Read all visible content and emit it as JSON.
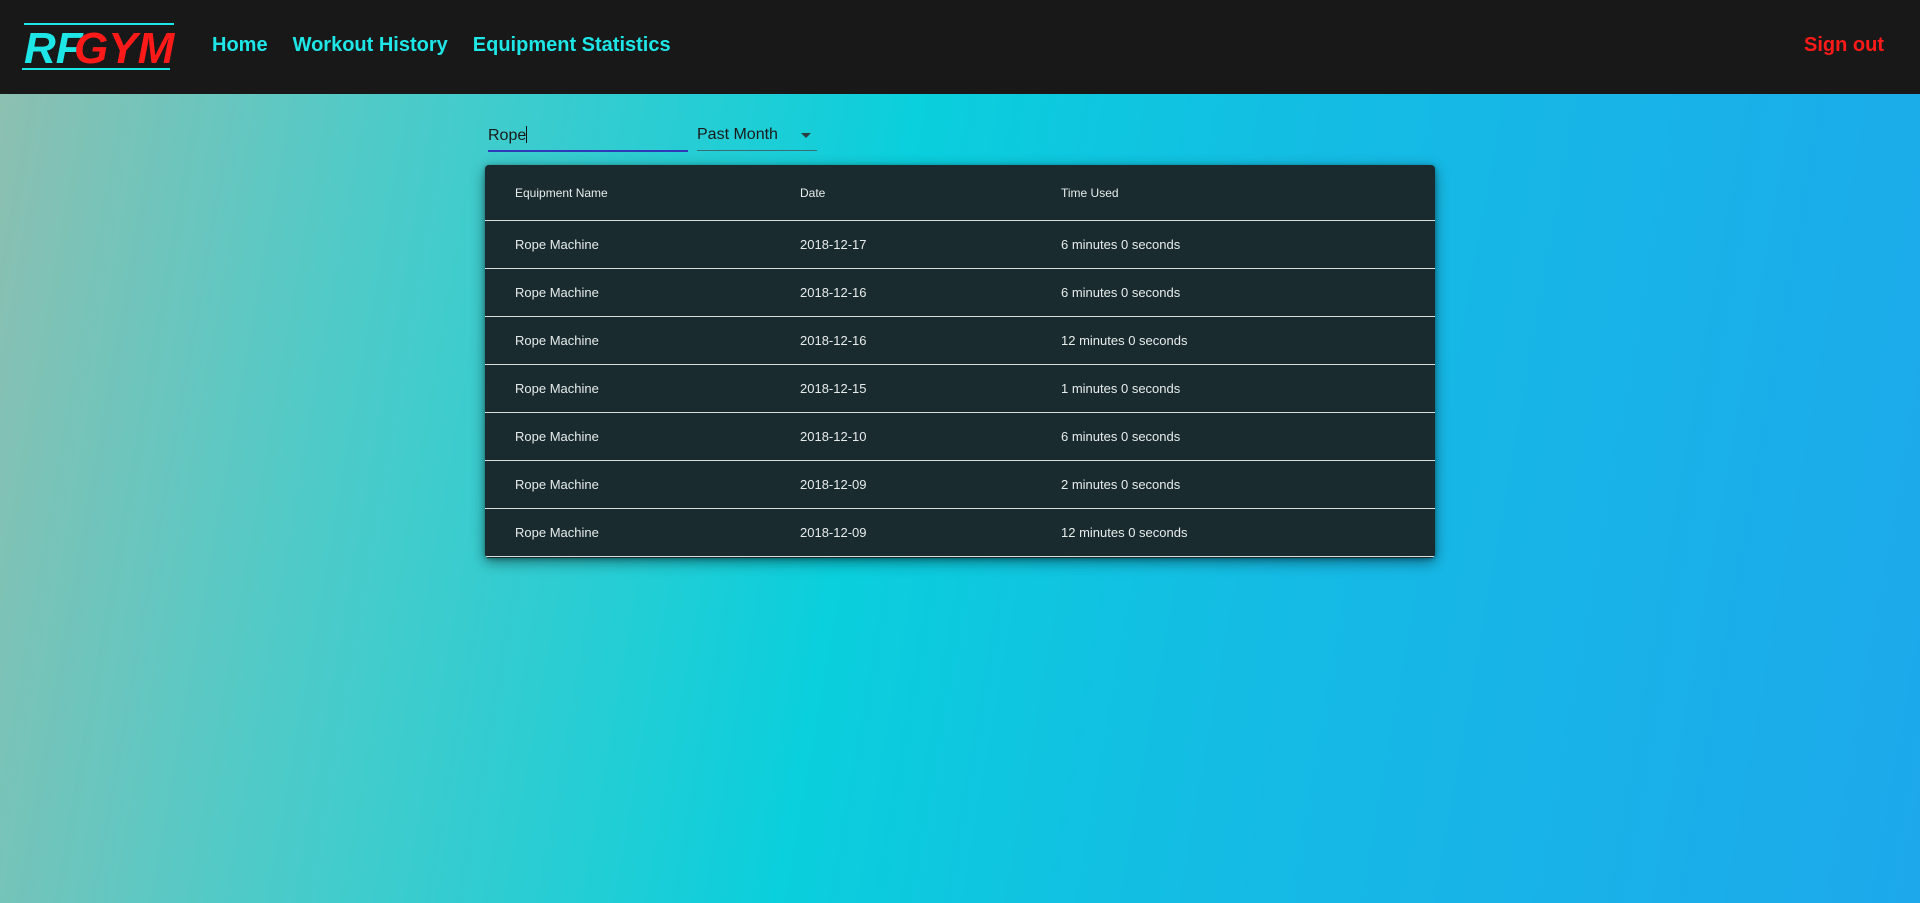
{
  "header": {
    "logo": {
      "part1": "RF",
      "part2": "GYM",
      "color1": "#1ee6e6",
      "color2": "#ff1a1a"
    },
    "nav": [
      {
        "label": "Home"
      },
      {
        "label": "Workout History"
      },
      {
        "label": "Equipment Statistics"
      }
    ],
    "sign_out": "Sign out"
  },
  "filters": {
    "search_value": "Rope",
    "period_selected": "Past Month"
  },
  "table": {
    "columns": [
      "Equipment Name",
      "Date",
      "Time Used"
    ],
    "rows": [
      [
        "Rope Machine",
        "2018-12-17",
        "6 minutes 0 seconds"
      ],
      [
        "Rope Machine",
        "2018-12-16",
        "6 minutes 0 seconds"
      ],
      [
        "Rope Machine",
        "2018-12-16",
        "12 minutes 0 seconds"
      ],
      [
        "Rope Machine",
        "2018-12-15",
        "1 minutes 0 seconds"
      ],
      [
        "Rope Machine",
        "2018-12-10",
        "6 minutes 0 seconds"
      ],
      [
        "Rope Machine",
        "2018-12-09",
        "2 minutes 0 seconds"
      ],
      [
        "Rope Machine",
        "2018-12-09",
        "12 minutes 0 seconds"
      ]
    ]
  }
}
